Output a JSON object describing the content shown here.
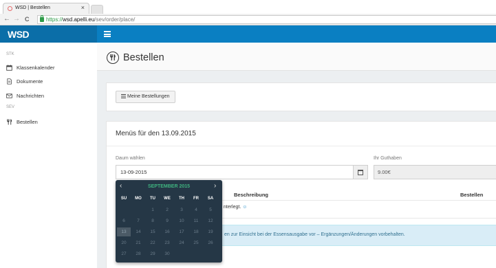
{
  "browser": {
    "tab_title": "WSD | Bestellen",
    "tab_close": "×",
    "url_scheme": "https://",
    "url_host": "wsd.apelli.eu",
    "url_path": "/sev/order/place/",
    "back": "←",
    "forward": "→",
    "reload": "C"
  },
  "header": {
    "logo": "WSD"
  },
  "sidebar": {
    "sections": [
      {
        "label": "STK",
        "items": [
          {
            "label": "Klassenkalender",
            "icon": "calendar-icon"
          },
          {
            "label": "Dokumente",
            "icon": "document-icon"
          },
          {
            "label": "Nachrichten",
            "icon": "envelope-icon"
          }
        ]
      },
      {
        "label": "SEV",
        "items": [
          {
            "label": "Bestellen",
            "icon": "cutlery-icon"
          }
        ]
      }
    ]
  },
  "page": {
    "title": "Bestellen"
  },
  "toolbar": {
    "my_orders_label": "Meine Bestellungen"
  },
  "menu_panel": {
    "title": "Menüs für den 13.09.2015",
    "date_label": "Daum wählen",
    "date_value": "13-09-2015",
    "balance_label": "Ihr Guthaben",
    "balance_value": "9.00€",
    "columns": {
      "description": "Beschreibung",
      "order": "Bestellen"
    },
    "note_partial": "nterlegt.",
    "info_partial": "en zur Einsicht bei der Essensausgabe vor – Ergänzungen/Änderungen vorbehalten."
  },
  "datepicker": {
    "prev": "‹",
    "next": "›",
    "month_label": "SEPTEMBER 2015",
    "weekdays": [
      "SU",
      "MO",
      "TU",
      "WE",
      "TH",
      "FR",
      "SA"
    ],
    "weeks": [
      [
        "",
        "",
        "1",
        "2",
        "3",
        "4",
        "5"
      ],
      [
        "6",
        "7",
        "8",
        "9",
        "10",
        "11",
        "12"
      ],
      [
        "13",
        "14",
        "15",
        "16",
        "17",
        "18",
        "19"
      ],
      [
        "20",
        "21",
        "22",
        "23",
        "24",
        "25",
        "26"
      ],
      [
        "27",
        "28",
        "29",
        "30",
        "",
        "",
        ""
      ]
    ],
    "selected_day": "13"
  },
  "colors": {
    "header_blue": "#0a7fc2",
    "logo_bg": "#0b6ea8",
    "datepicker_bg": "#253746",
    "datepicker_title": "#3fb37f",
    "info_bg": "#d9edf7"
  }
}
